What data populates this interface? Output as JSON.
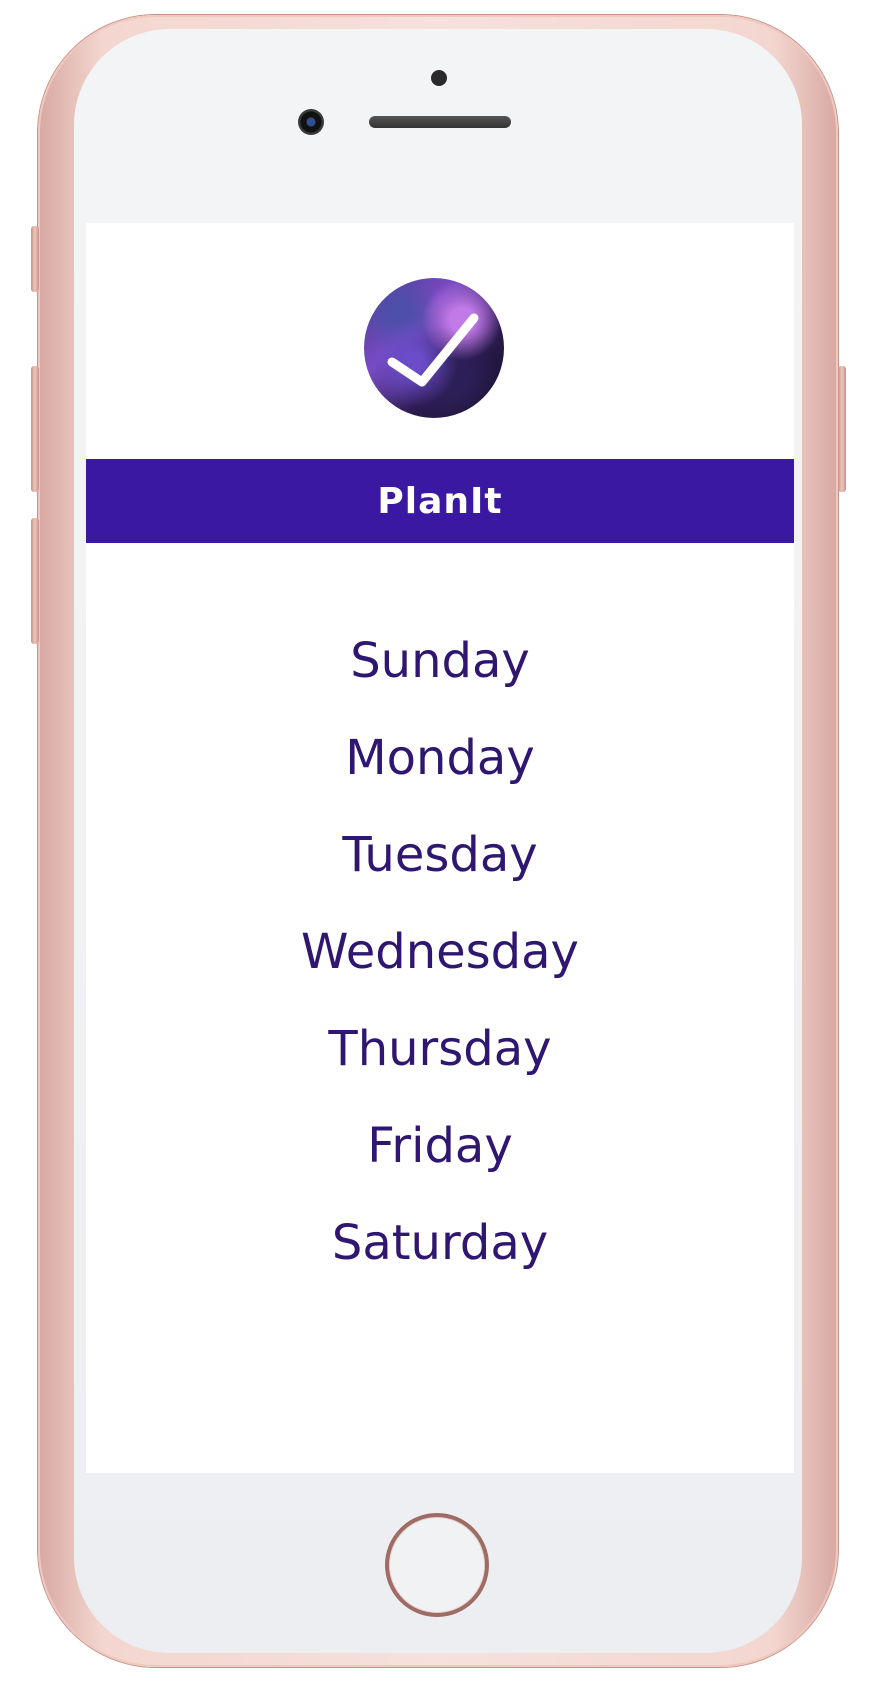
{
  "app": {
    "title": "PlanIt",
    "logo_icon": "checkmark-galaxy-icon"
  },
  "days": [
    "Sunday",
    "Monday",
    "Tuesday",
    "Wednesday",
    "Thursday",
    "Friday",
    "Saturday"
  ],
  "colors": {
    "header_background": "#3a18a1",
    "day_text": "#2f1670",
    "phone_frame": "#f3d6cf"
  }
}
